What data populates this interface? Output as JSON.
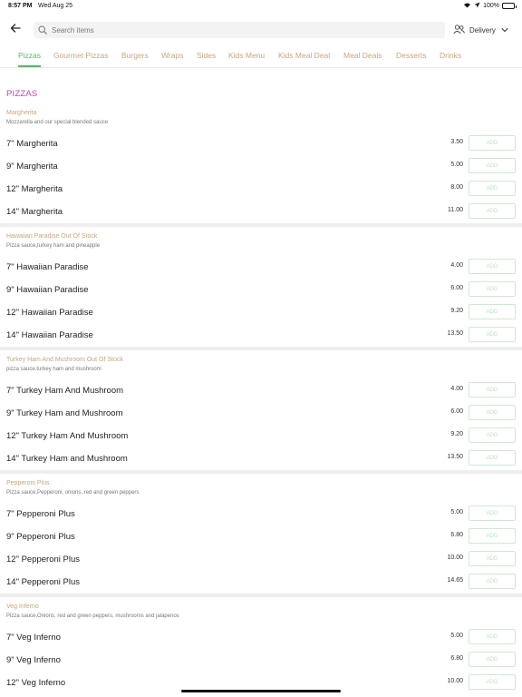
{
  "status_bar": {
    "time": "8:57 PM",
    "date": "Wed Aug 25",
    "battery": "100%"
  },
  "search": {
    "placeholder": "Search items"
  },
  "delivery": {
    "label": "Delivery"
  },
  "tabs": [
    {
      "label": "Pizzas",
      "active": true
    },
    {
      "label": "Gourmet Pizzas"
    },
    {
      "label": "Burgers"
    },
    {
      "label": "Wraps"
    },
    {
      "label": "Sides"
    },
    {
      "label": "Kids Menu"
    },
    {
      "label": "Kids Meal Deal"
    },
    {
      "label": "Meal Deals"
    },
    {
      "label": "Desserts"
    },
    {
      "label": "Drinks"
    }
  ],
  "section_title": "PIZZAS",
  "add_label": "ADD",
  "groups": [
    {
      "name": "Margherita",
      "desc": "Mozzarella and our special blended sauce",
      "items": [
        {
          "name": "7\" Margherita",
          "price": "3.50"
        },
        {
          "name": "9\" Margherita",
          "price": "5.00"
        },
        {
          "name": "12\" Margherita",
          "price": "8.00"
        },
        {
          "name": "14\" Margherita",
          "price": "11.00"
        }
      ]
    },
    {
      "name": "Hawaiian Paradise Out Of Stock",
      "desc": "Pizza sauce,turkey ham and pineapple",
      "items": [
        {
          "name": "7\" Hawaiian Paradise",
          "price": "4.00"
        },
        {
          "name": "9\" Hawaiian Paradise",
          "price": "6.00"
        },
        {
          "name": "12\" Hawaiian Paradise",
          "price": "9.20"
        },
        {
          "name": "14\" Hawaiian Paradise",
          "price": "13.50"
        }
      ]
    },
    {
      "name": "Turkey Ham And Mushroom Out Of Stock",
      "desc": "pizza sauce,turkey ham and mushroom",
      "items": [
        {
          "name": "7\" Turkey Ham And Mushroom",
          "price": "4.00"
        },
        {
          "name": "9\" Turkey Ham and Mushroom",
          "price": "6.00"
        },
        {
          "name": "12\" Turkey Ham And Mushroom",
          "price": "9.20"
        },
        {
          "name": "14\" Turkey Ham and Mushroom",
          "price": "13.50"
        }
      ]
    },
    {
      "name": "Pepperoni Plus",
      "desc": "Pizza sauce,Pepperoni, onions, red and green peppers",
      "items": [
        {
          "name": "7\" Pepperoni Plus",
          "price": "5.00"
        },
        {
          "name": "9\" Pepperoni Plus",
          "price": "6.80"
        },
        {
          "name": "12\" Pepperoni Plus",
          "price": "10.00"
        },
        {
          "name": "14\" Pepperoni Plus",
          "price": "14.65"
        }
      ]
    },
    {
      "name": "Veg Inferno",
      "desc": "Pizza sauce,Onions, red and green peppers, mushrooms and jalapenos",
      "items": [
        {
          "name": "7\" Veg Inferno",
          "price": "5.00"
        },
        {
          "name": "9\" Veg Inferno",
          "price": "6.80"
        },
        {
          "name": "12\" Veg Inferno",
          "price": "10.00"
        }
      ]
    }
  ],
  "colors": {
    "accent_green": "#58b568",
    "tab_tan": "#c5a680",
    "section_purple": "#b94aaa",
    "add_border": "#cfe8d4"
  }
}
